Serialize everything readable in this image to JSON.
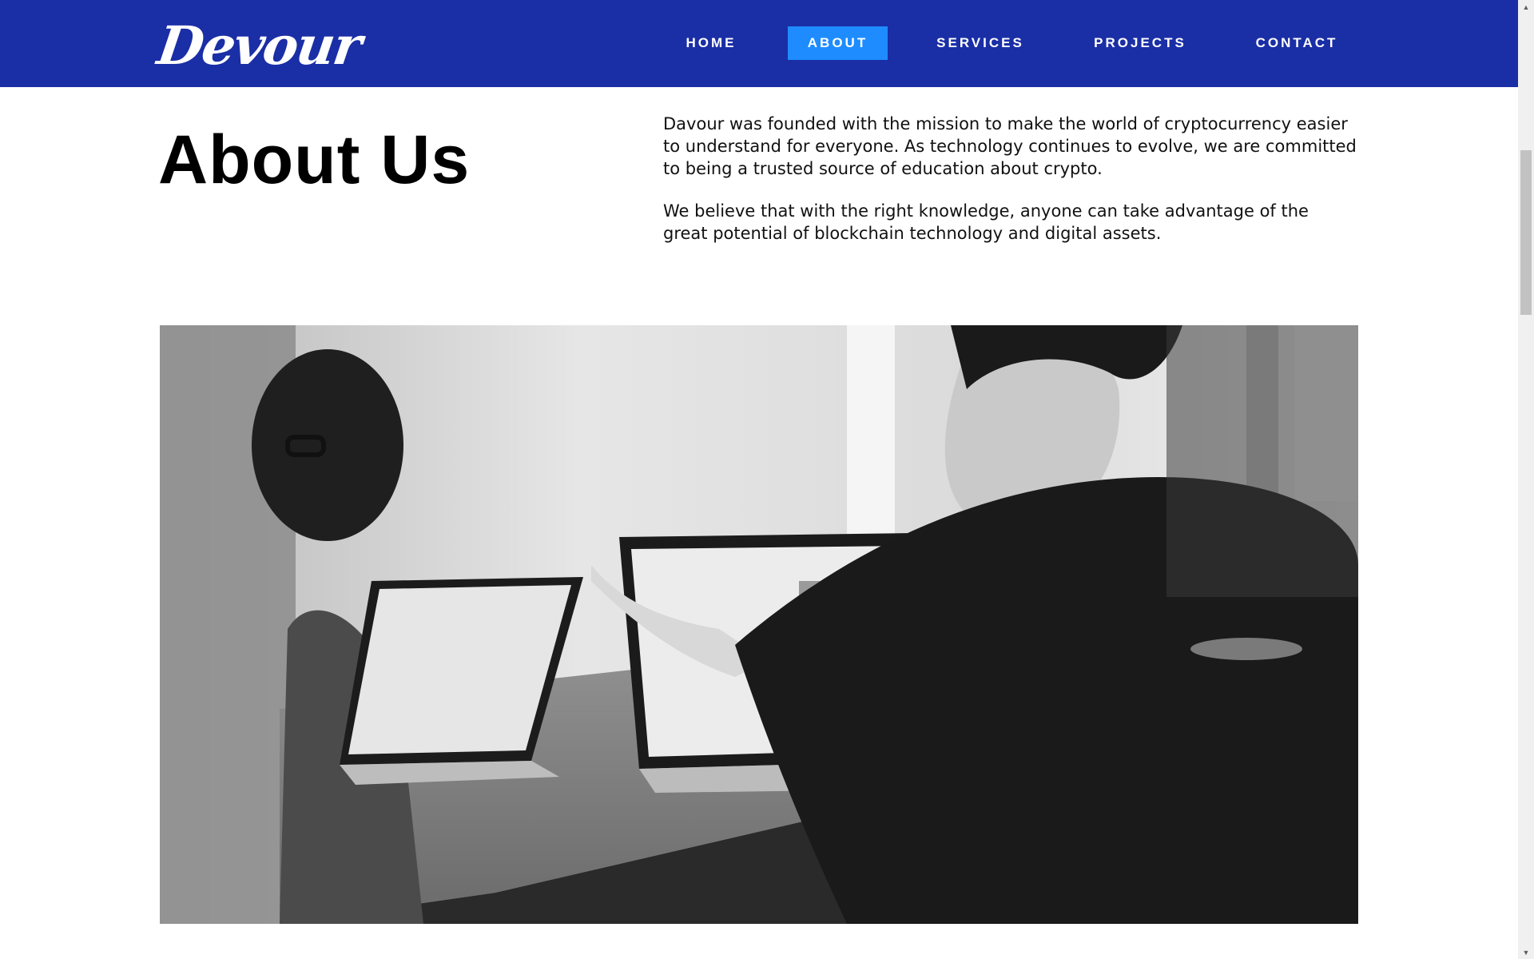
{
  "brand": {
    "logo_text": "Devour"
  },
  "nav": {
    "items": [
      {
        "label": "HOME",
        "active": false
      },
      {
        "label": "ABOUT",
        "active": true
      },
      {
        "label": "SERVICES",
        "active": false
      },
      {
        "label": "PROJECTS",
        "active": false
      },
      {
        "label": "CONTACT",
        "active": false
      }
    ]
  },
  "about": {
    "title": "About Us",
    "paragraphs": [
      "Davour was founded with the mission to make the world of cryptocurrency easier to understand for everyone. As technology continues to evolve, we are committed to being a trusted source of education about crypto.",
      "We believe that with the right knowledge, anyone can take advantage of the great potential of blockchain technology and digital assets."
    ]
  },
  "image": {
    "subject": "team-working-on-laptops-photo"
  },
  "colors": {
    "header_bg": "#1a2ea6",
    "nav_active_bg": "#1e8cff",
    "text": "#000000"
  },
  "scrollbar": {
    "up_icon": "chevron-up-icon",
    "down_icon": "chevron-down-icon"
  }
}
